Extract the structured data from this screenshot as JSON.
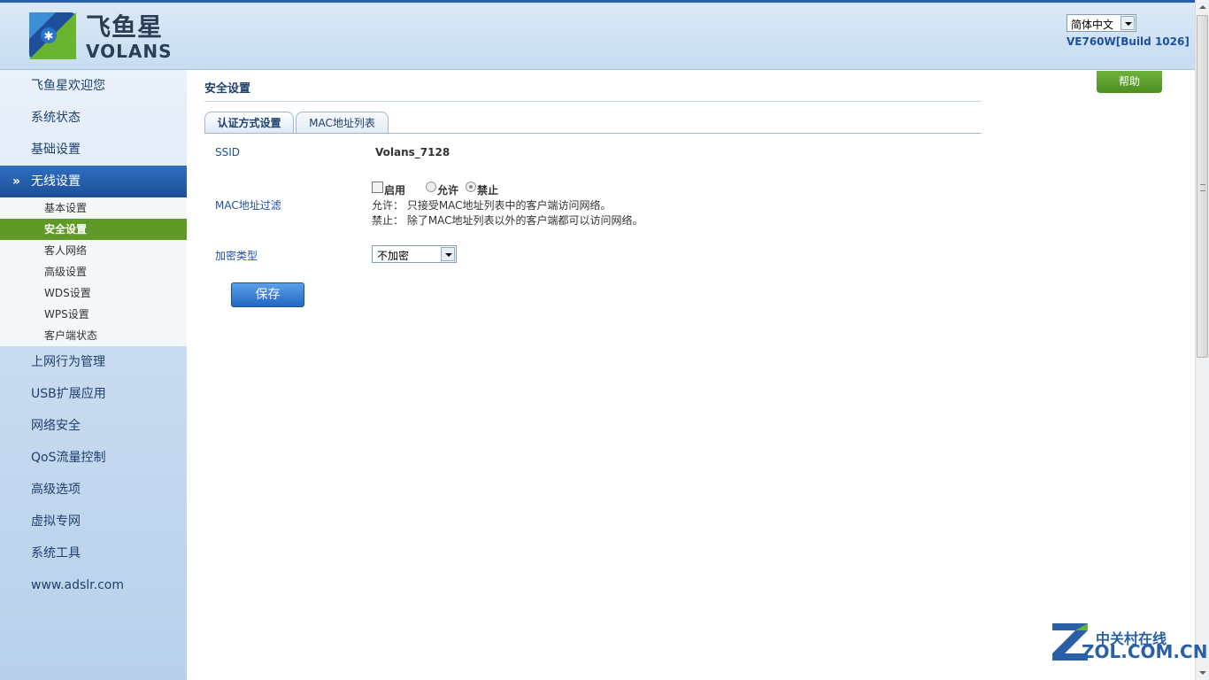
{
  "header": {
    "logo_cn": "飞鱼星",
    "logo_en": "VOLANS",
    "language": "简体中文",
    "build": "VE760W[Build 1026]"
  },
  "sidebar": {
    "items": [
      {
        "label": "飞鱼星欢迎您"
      },
      {
        "label": "系统状态"
      },
      {
        "label": "基础设置"
      },
      {
        "label": "无线设置",
        "active": true
      },
      {
        "label": "上网行为管理"
      },
      {
        "label": "USB扩展应用"
      },
      {
        "label": "网络安全"
      },
      {
        "label": "QoS流量控制"
      },
      {
        "label": "高级选项"
      },
      {
        "label": "虚拟专网"
      },
      {
        "label": "系统工具"
      },
      {
        "label": "www.adslr.com"
      }
    ],
    "sub_items": [
      {
        "label": "基本设置"
      },
      {
        "label": "安全设置",
        "active": true
      },
      {
        "label": "客人网络"
      },
      {
        "label": "高级设置"
      },
      {
        "label": "WDS设置"
      },
      {
        "label": "WPS设置"
      },
      {
        "label": "客户端状态"
      }
    ]
  },
  "main": {
    "title": "安全设置",
    "help_label": "帮助",
    "tabs": [
      {
        "label": "认证方式设置",
        "active": true
      },
      {
        "label": "MAC地址列表"
      }
    ],
    "ssid_label": "SSID",
    "ssid_value": "Volans_7128",
    "mac_filter_label": "MAC地址过滤",
    "enable_label": "启用",
    "allow_label": "允许",
    "deny_label": "禁止",
    "allow_desc": "允许： 只接受MAC地址列表中的客户端访问网络。",
    "deny_desc": "禁止： 除了MAC地址列表以外的客户端都可以访问网络。",
    "encryption_label": "加密类型",
    "encryption_value": "不加密",
    "save_label": "保存"
  },
  "watermark": {
    "cn": "中关村在线",
    "en": "ZOL.COM.CN"
  },
  "colors": {
    "accent_blue": "#1f4f9c",
    "active_nav": "#2f6fc1",
    "active_sub": "#5f9a26",
    "help_green": "#5a9e2c"
  }
}
